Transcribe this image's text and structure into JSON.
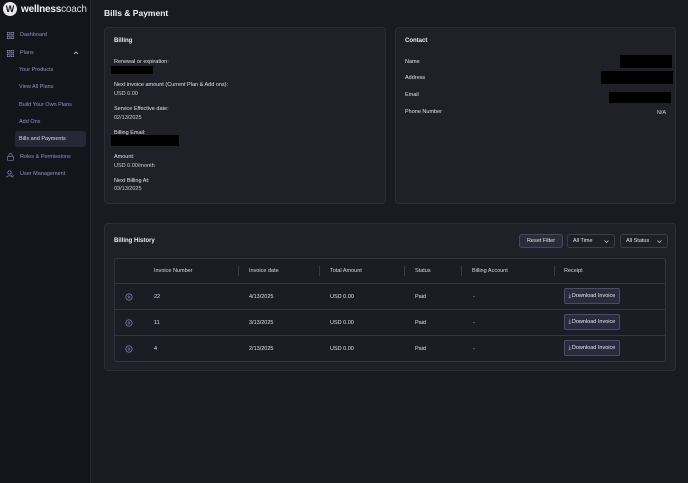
{
  "brand": {
    "logo_letter": "W",
    "name_bold": "wellness",
    "name_light": "coach"
  },
  "sidebar": {
    "items": [
      {
        "label": "Dashboard",
        "icon": "grid-icon"
      },
      {
        "label": "Plans",
        "icon": "grid-icon",
        "expanded": true
      },
      {
        "label": "Your Products",
        "sub": true
      },
      {
        "label": "View All Plans",
        "sub": true
      },
      {
        "label": "Build Your Own Plans",
        "sub": true
      },
      {
        "label": "Add Ons",
        "sub": true
      },
      {
        "label": "Bills and Payments",
        "sub": true,
        "active": true
      },
      {
        "label": "Roles & Permissions",
        "icon": "lock-icon"
      },
      {
        "label": "User Management",
        "icon": "user-icon"
      }
    ]
  },
  "page": {
    "title": "Bills & Payment"
  },
  "billing": {
    "title": "Billing",
    "renewal_label": "Renewal or expiration:",
    "next_invoice_label": "Next invoice amount (Current Plan & Add ons):",
    "next_invoice_value": "USD 0.00",
    "service_date_label": "Service Effective date:",
    "service_date_value": "02/13/2025",
    "billing_email_label": "Billing Email:",
    "amount_label": "Amount:",
    "amount_value": "USD 0.00/month",
    "next_billing_label": "Next Billing At:",
    "next_billing_value": "03/13/2025"
  },
  "contact": {
    "title": "Contact",
    "name_label": "Name",
    "address_label": "Address",
    "email_label": "Email",
    "phone_label": "Phone Number",
    "phone_value": "N/A"
  },
  "history": {
    "title": "Billing History",
    "reset_label": "Reset Filter",
    "time_filter": "All Time",
    "status_filter": "All Status",
    "columns": [
      "Invoice Number",
      "Invoice date",
      "Total Amount",
      "Status",
      "Billing Account",
      "Receipt"
    ],
    "rows": [
      {
        "number": "22",
        "date": "4/13/2025",
        "amount": "USD 0.00",
        "status": "Paid",
        "account": "-",
        "receipt": "Download Invoice"
      },
      {
        "number": "11",
        "date": "3/13/2025",
        "amount": "USD 0.00",
        "status": "Paid",
        "account": "-",
        "receipt": "Download Invoice"
      },
      {
        "number": "4",
        "date": "2/13/2025",
        "amount": "USD 0.00",
        "status": "Paid",
        "account": "-",
        "receipt": "Download Invoice"
      }
    ]
  },
  "colors": {
    "accent": "#8f93c8",
    "background": "#1a1b22",
    "card": "#1f2028",
    "redaction": "#000000"
  }
}
